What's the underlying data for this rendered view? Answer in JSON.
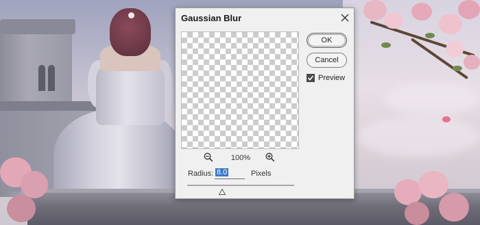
{
  "dialog": {
    "title": "Gaussian Blur",
    "ok_label": "OK",
    "cancel_label": "Cancel",
    "preview_label": "Preview",
    "preview_checked": true,
    "zoom_level": "100%",
    "radius_label": "Radius:",
    "radius_value": "8.0",
    "units_label": "Pixels"
  },
  "icons": {
    "close": "close-icon",
    "zoom_out": "zoom-out-icon",
    "zoom_in": "zoom-in-icon",
    "check": "checkmark-icon",
    "slider": "slider-thumb-icon"
  },
  "colors": {
    "dialog_bg": "#f0f0f0",
    "selection": "#3b78c6",
    "checker": "#cccccc"
  }
}
